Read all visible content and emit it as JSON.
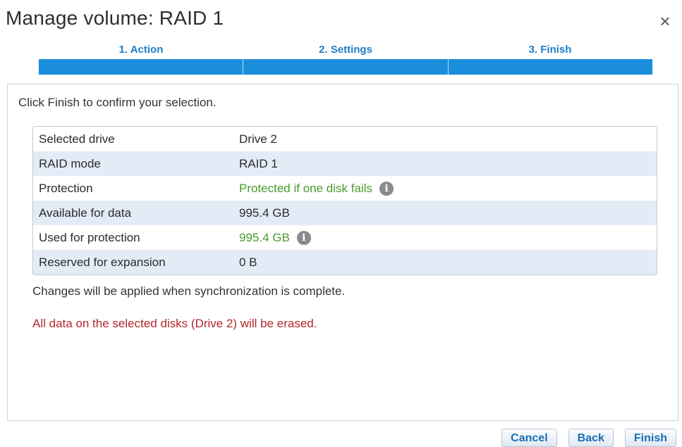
{
  "dialog": {
    "title": "Manage volume: RAID 1",
    "close_symbol": "×"
  },
  "steps": [
    {
      "label": "1. Action"
    },
    {
      "label": "2. Settings"
    },
    {
      "label": "3. Finish"
    }
  ],
  "intro": "Click Finish to confirm your selection.",
  "summary": {
    "rows": [
      {
        "label": "Selected drive",
        "value": "Drive 2"
      },
      {
        "label": "RAID mode",
        "value": "RAID 1"
      },
      {
        "label": "Protection",
        "value": "Protected if one disk fails"
      },
      {
        "label": "Available for data",
        "value": "995.4 GB"
      },
      {
        "label": "Used for protection",
        "value": "995.4 GB"
      },
      {
        "label": "Reserved for expansion",
        "value": "0 B"
      }
    ]
  },
  "note": "Changes will be applied when synchronization is complete.",
  "warning": "All data on the selected disks (Drive 2) will be erased.",
  "buttons": {
    "cancel": "Cancel",
    "back": "Back",
    "finish": "Finish"
  },
  "colors": {
    "accent": "#1a8ddb",
    "success_text": "#4a9b2f",
    "warning_text": "#b3272c",
    "alt_row": "#e3ecf6"
  },
  "icons": {
    "info": "info-icon",
    "close": "close-icon"
  }
}
